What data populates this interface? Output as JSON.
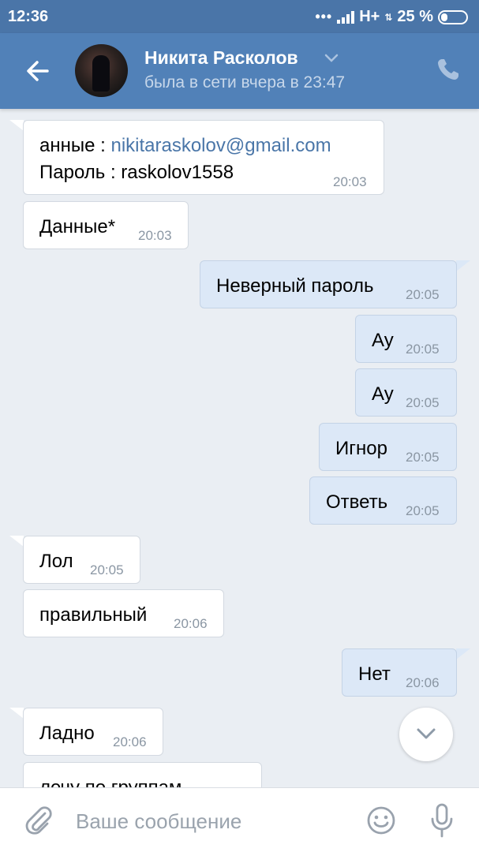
{
  "status_bar": {
    "time": "12:36",
    "network": "H+",
    "battery": "25 %"
  },
  "header": {
    "name": "Никита Расколов",
    "last_seen": "была в сети вчера в 23:47"
  },
  "messages": [
    {
      "dir": "in",
      "line1_prefix": "анные : ",
      "line1_link": "nikitaraskolov@gmail.com",
      "line2": "Пароль : raskolov1558",
      "time": "20:03"
    },
    {
      "dir": "in",
      "text": "Данные*",
      "time": "20:03"
    },
    {
      "dir": "out",
      "text": "Неверный пароль",
      "time": "20:05"
    },
    {
      "dir": "out",
      "text": "Ау",
      "time": "20:05"
    },
    {
      "dir": "out",
      "text": "Ау",
      "time": "20:05"
    },
    {
      "dir": "out",
      "text": "Игнор",
      "time": "20:05"
    },
    {
      "dir": "out",
      "text": "Ответь",
      "time": "20:05"
    },
    {
      "dir": "in",
      "text": "Лол",
      "time": "20:05"
    },
    {
      "dir": "in",
      "text": "правильный",
      "time": "20:06"
    },
    {
      "dir": "out",
      "text": "Нет",
      "time": "20:06"
    },
    {
      "dir": "in",
      "text": "Ладно",
      "time": "20:06"
    },
    {
      "dir": "in",
      "text": "лечу по группам",
      "time": ""
    }
  ],
  "composer": {
    "placeholder": "Ваше сообщение"
  },
  "colors": {
    "header": "#5181b8",
    "status_bar": "#4a75a8",
    "chat_bg": "#eaeef3",
    "outgoing_bubble": "#dce8f7",
    "incoming_bubble": "#ffffff",
    "link": "#4a76a8"
  },
  "icons": {
    "back": "arrow-left-icon",
    "name_dropdown": "chevron-down-icon",
    "call": "phone-icon",
    "scroll": "chevron-down-icon",
    "attach": "paperclip-icon",
    "emoji": "smiley-icon",
    "voice": "microphone-icon"
  }
}
